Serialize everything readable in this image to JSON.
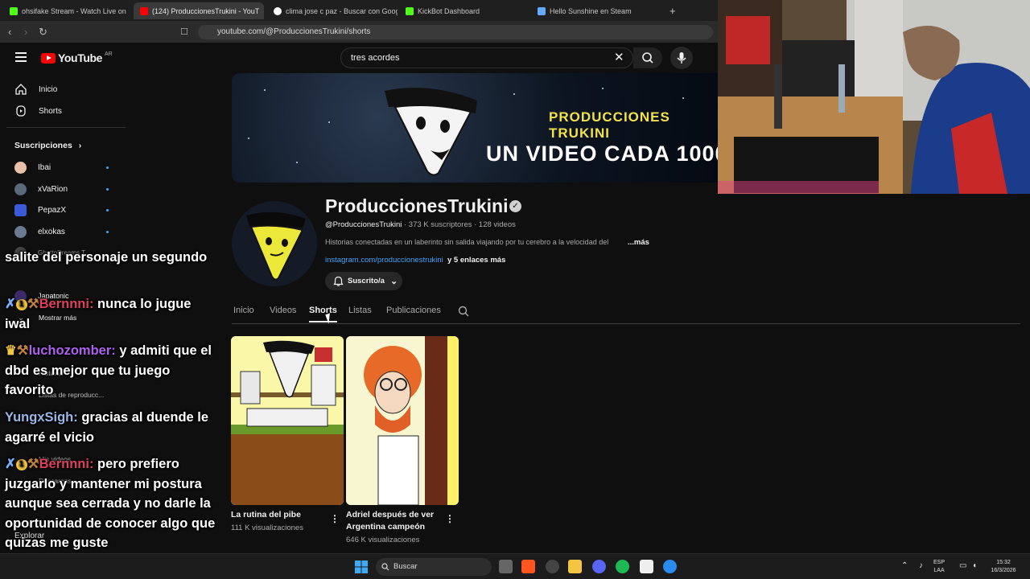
{
  "browser": {
    "tabs": [
      {
        "title": "ohsifake Stream - Watch Live on"
      },
      {
        "title": "(124) ProduccionesTrukini - YouT"
      },
      {
        "title": "clima jose c paz - Buscar con Google"
      },
      {
        "title": "KickBot Dashboard"
      },
      {
        "title": "Hello Sunshine en Steam"
      }
    ],
    "new_tab": "+",
    "url": "youtube.com/@ProduccionesTrukini/shorts"
  },
  "youtube": {
    "logo_text": "YouTube",
    "country": "AR",
    "search_value": "tres acordes"
  },
  "sidebar": {
    "nav": [
      {
        "label": "Inicio",
        "icon": "home-icon"
      },
      {
        "label": "Shorts",
        "icon": "shorts-icon"
      }
    ],
    "subscriptions_heading": "Suscripciones",
    "subscriptions": [
      {
        "name": "Ibai",
        "color": "#e8c0a8"
      },
      {
        "name": "xVaRion",
        "color": "#5a6a7a"
      },
      {
        "name": "PepazX",
        "color": "#3a5ad8"
      },
      {
        "name": "elxokas",
        "color": "#6a7a90"
      },
      {
        "name": "Gh..."
      },
      {
        "name": "Japatonic",
        "color": "#3a2a6a"
      }
    ],
    "partial_labels": {
      "ghetto": "GhettoDreams T...",
      "mostrar": "Mostrar más",
      "historial": "Historial",
      "listas": "Listas de reproducc...",
      "mis_videos": "Mis videos",
      "descargas": "Descargas",
      "explorar": "Explorar"
    }
  },
  "chat": [
    {
      "user": "",
      "text": "salite del personaje un segundo",
      "color": ""
    },
    {
      "user": "Bernnni:",
      "text": " nunca lo jugue iwal",
      "color": "red"
    },
    {
      "user": "luchozomber:",
      "text": " y admiti que el dbd es mejor que tu juego favorito",
      "color": "purple"
    },
    {
      "user": "YungxSigh:",
      "text": " gracias al duende le agarré el vicio",
      "color": "blue"
    },
    {
      "user": "Bernnni:",
      "text": " pero prefiero juzgarlo y mantener mi postura aunque sea cerrada y no darle la oportunidad de conocer algo que quizas me guste",
      "color": "red"
    }
  ],
  "banner": {
    "line1": "PRODUCCIONES TRUKINI",
    "line2": "UN VIDEO CADA 1000 A"
  },
  "channel": {
    "name": "ProduccionesTrukini",
    "verified": "✓",
    "handle": "@ProduccionesTrukini",
    "meta": "· 373 K suscriptores · 128 videos",
    "description": "Historias conectadas en un laberinto sin salida viajando por tu cerebro a la velocidad del",
    "more": "...más",
    "link": "instagram.com/produccionestrukini",
    "links_more": "y 5 enlaces más",
    "subscribe_label": "Suscrito/a"
  },
  "channel_tabs": [
    {
      "label": "Inicio"
    },
    {
      "label": "Videos"
    },
    {
      "label": "Shorts",
      "active": true
    },
    {
      "label": "Listas"
    },
    {
      "label": "Publicaciones"
    }
  ],
  "shorts": [
    {
      "title": "La rutina del pibe",
      "views": "111 K visualizaciones"
    },
    {
      "title": "Adriel después de ver Argentina campeón",
      "views": "646 K visualizaciones"
    }
  ],
  "taskbar": {
    "search_label": "Buscar",
    "lang": "ESP",
    "layout": "LAA",
    "time": "15:32",
    "date": "16/3/2026"
  },
  "colors": {
    "accent_red": "#ff0000",
    "link_blue": "#3ea6ff",
    "background": "#0f0f0f"
  }
}
